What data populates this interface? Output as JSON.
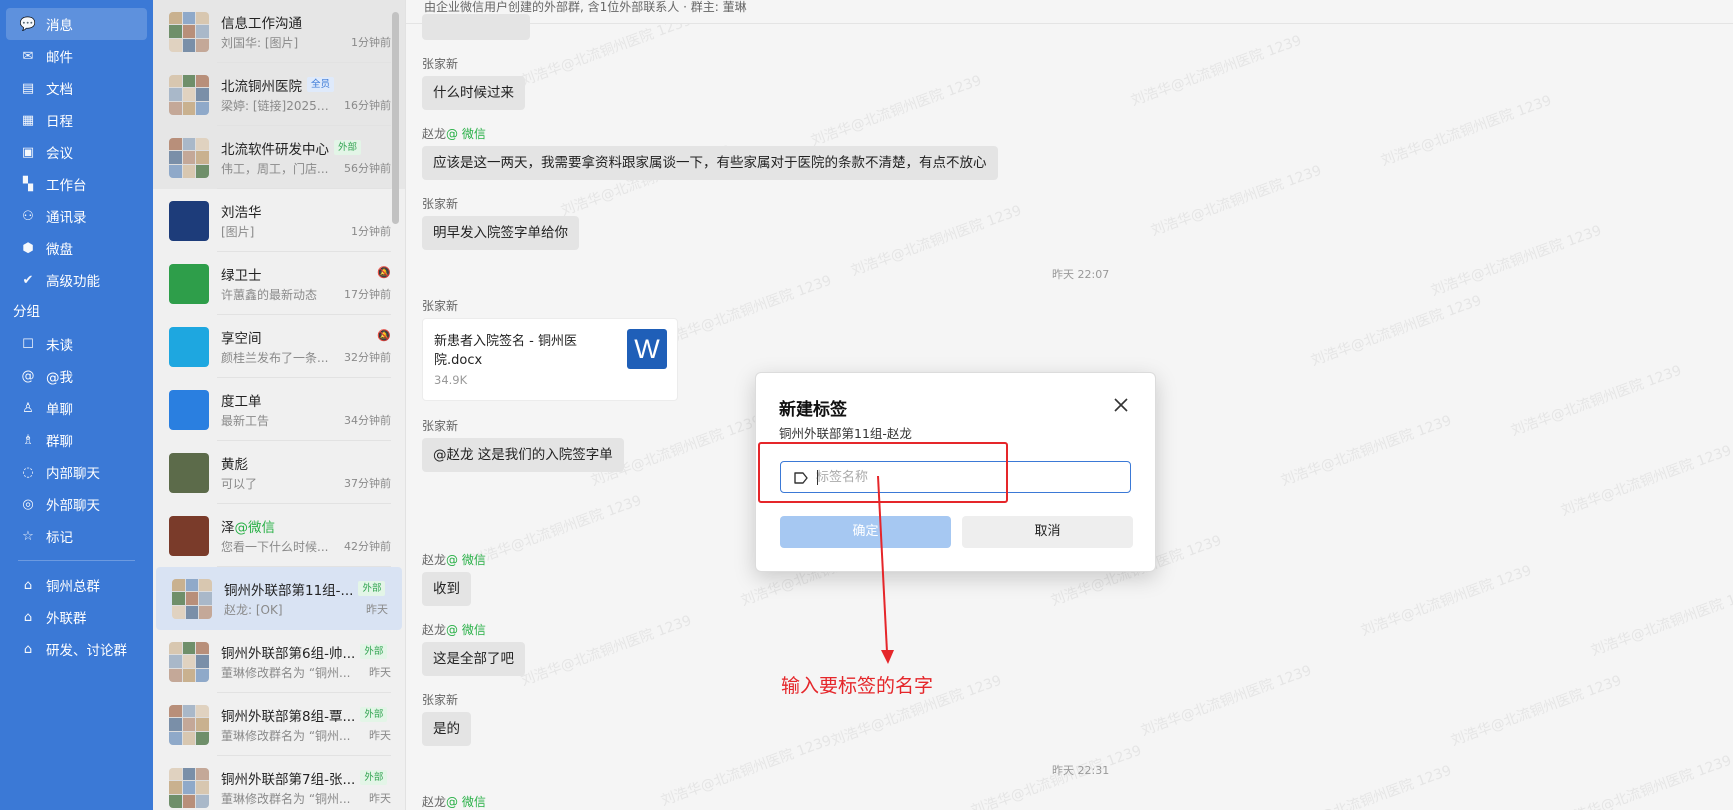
{
  "nav": {
    "items": [
      {
        "label": "消息",
        "icon": "chat-bubble-icon",
        "glyph": "💬",
        "active": true
      },
      {
        "label": "邮件",
        "icon": "mail-icon",
        "glyph": "✉"
      },
      {
        "label": "文档",
        "icon": "document-icon",
        "glyph": "▤"
      },
      {
        "label": "日程",
        "icon": "calendar-icon",
        "glyph": "▦"
      },
      {
        "label": "会议",
        "icon": "meeting-icon",
        "glyph": "▣"
      },
      {
        "label": "工作台",
        "icon": "workbench-icon",
        "glyph": "▚"
      },
      {
        "label": "通讯录",
        "icon": "contacts-icon",
        "glyph": "⚇"
      },
      {
        "label": "微盘",
        "icon": "drive-icon",
        "glyph": "⬢"
      },
      {
        "label": "高级功能",
        "icon": "advanced-icon",
        "glyph": "✔"
      }
    ],
    "group_title": "分组",
    "filters": [
      {
        "label": "未读",
        "icon": "unread-icon",
        "glyph": "☐"
      },
      {
        "label": "@我",
        "icon": "at-icon",
        "glyph": "@"
      },
      {
        "label": "单聊",
        "icon": "single-chat-icon",
        "glyph": "♙"
      },
      {
        "label": "群聊",
        "icon": "group-chat-icon",
        "glyph": "♗"
      },
      {
        "label": "内部聊天",
        "icon": "internal-chat-icon",
        "glyph": "◌"
      },
      {
        "label": "外部聊天",
        "icon": "external-chat-icon",
        "glyph": "◎"
      },
      {
        "label": "标记",
        "icon": "star-icon",
        "glyph": "☆"
      }
    ],
    "custom_groups": [
      {
        "label": "铜州总群",
        "icon": "tag-icon",
        "glyph": "⌂"
      },
      {
        "label": "外联群",
        "icon": "tag-icon",
        "glyph": "⌂"
      },
      {
        "label": "研发、讨论群",
        "icon": "tag-icon",
        "glyph": "⌂"
      }
    ]
  },
  "conversations": [
    {
      "name": "信息工作沟通",
      "last": "刘国华: [图片]",
      "time": "1分钟前",
      "pinned": true,
      "avatar": "grid"
    },
    {
      "name": "北流铜州医院",
      "tag": "全员",
      "tag_type": "all",
      "last": "梁婷: [链接]2025年...",
      "time": "16分钟前",
      "pinned": true,
      "avatar": "grid"
    },
    {
      "name": "北流软件研发中心",
      "tag": "外部",
      "tag_type": "ext",
      "last": "伟工，周工，门店...",
      "time": "56分钟前",
      "pinned": true,
      "avatar": "grid"
    },
    {
      "name": "刘浩华",
      "last": "[图片]",
      "time": "1分钟前",
      "avatar": "single",
      "avatar_color": "#1d3c7a"
    },
    {
      "name": "绿卫士",
      "last": "许蕙鑫的最新动态",
      "time": "17分钟前",
      "muted": true,
      "avatar": "single",
      "avatar_color": "#2e9e4a"
    },
    {
      "name": "享空间",
      "last": "颜桂兰发布了一条...",
      "time": "32分钟前",
      "muted": true,
      "avatar": "single",
      "avatar_color": "#1ea7e0"
    },
    {
      "name": "度工单",
      "last": "最新工告",
      "time": "34分钟前",
      "avatar": "single",
      "avatar_color": "#2a7fe0"
    },
    {
      "name": "黄彪",
      "last": "可以了",
      "time": "37分钟前",
      "avatar": "single",
      "avatar_color": "#5c6b4a"
    },
    {
      "name": "泽",
      "name_suffix": "@微信",
      "last": "您看一下什么时候...",
      "time": "42分钟前",
      "avatar": "single",
      "avatar_color": "#7a3b2a"
    },
    {
      "name": "铜州外联部第11组-...",
      "tag": "外部",
      "tag_type": "ext",
      "last": "赵龙: [OK]",
      "time": "昨天",
      "selected": true,
      "avatar": "grid"
    },
    {
      "name": "铜州外联部第6组-帅...",
      "tag": "外部",
      "tag_type": "ext",
      "last": "董琳修改群名为 “铜州...",
      "time": "昨天",
      "avatar": "grid"
    },
    {
      "name": "铜州外联部第8组-覃...",
      "tag": "外部",
      "tag_type": "ext",
      "last": "董琳修改群名为 “铜州...",
      "time": "昨天",
      "avatar": "grid"
    },
    {
      "name": "铜州外联部第7组-张...",
      "tag": "外部",
      "tag_type": "ext",
      "last": "董琳修改群名为 “铜州...",
      "time": "昨天",
      "avatar": "grid"
    }
  ],
  "chat": {
    "header_info": "由企业微信用户创建的外部群, 含1位外部联系人 · 群主: 董琳",
    "messages": [
      {
        "sender": "张家新",
        "text": "什么时候过来"
      },
      {
        "sender": "赵龙",
        "sender_suffix": "@ 微信",
        "text": "应该是这一两天，我需要拿资料跟家属谈一下，有些家属对于医院的条款不清楚，有点不放心"
      },
      {
        "sender": "张家新",
        "text": "明早发入院签字单给你"
      },
      {
        "sender": "张家新",
        "file_name": "新患者入院签名 - 铜州医院.docx",
        "file_size": "34.9K",
        "file_icon": "W"
      },
      {
        "sender": "张家新",
        "text": "@赵龙 这是我们的入院签字单"
      },
      {
        "sender": "赵龙",
        "sender_suffix": "@ 微信",
        "text": "收到"
      },
      {
        "sender": "赵龙",
        "sender_suffix": "@ 微信",
        "text": "这是全部了吧"
      },
      {
        "sender": "张家新",
        "text": "是的"
      },
      {
        "sender": "赵龙",
        "sender_suffix": "@ 微信"
      }
    ],
    "timestamps": [
      "昨天 22:07",
      "昨天 22:31"
    ],
    "watermark": "刘浩华@北流铜州医院 1239"
  },
  "dialog": {
    "title": "新建标签",
    "subtitle": "铜州外联部第11组-赵龙",
    "input_value": "",
    "input_placeholder": "标签名称",
    "confirm_label": "确定",
    "cancel_label": "取消"
  },
  "annotation": {
    "text": "输入要标签的名字",
    "color": "#e5262a"
  },
  "colors": {
    "nav_bg": "#3b79d6",
    "selected_conv": "#d9e3f3",
    "external_tag": "#33a552",
    "confirm_disabled": "#a6c8f2"
  }
}
